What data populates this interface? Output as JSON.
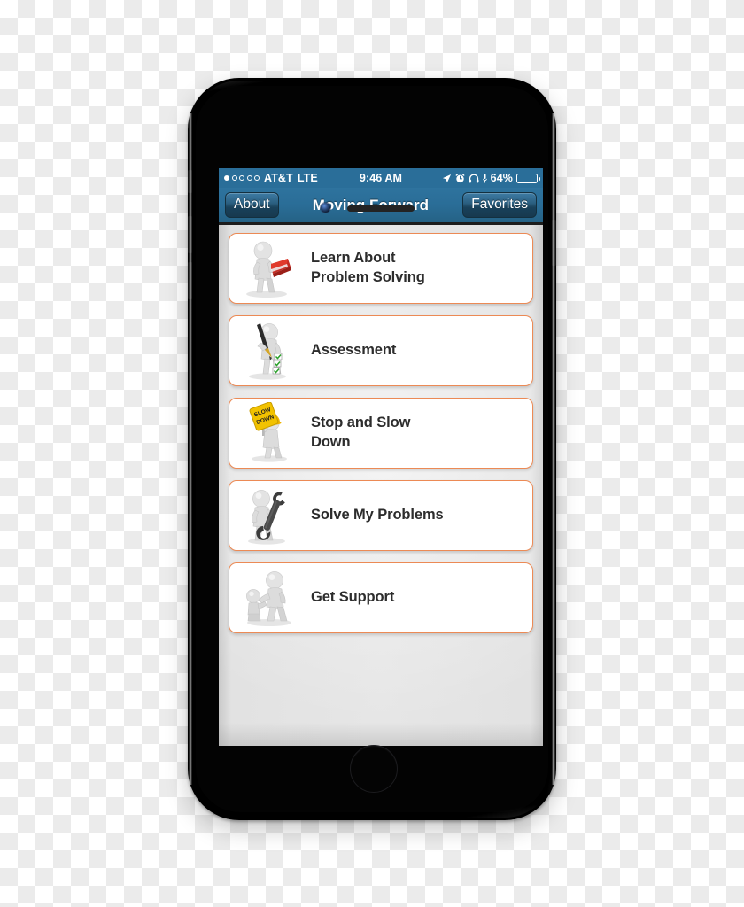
{
  "device": {
    "name": "iphone-mockup",
    "camera": "front-camera",
    "earpiece": "earpiece-speaker",
    "home_button": "home-button",
    "buttons": [
      "mute-switch",
      "volume-up",
      "volume-down",
      "power-button"
    ]
  },
  "status_bar": {
    "signal_dots": [
      true,
      false,
      false,
      false,
      false
    ],
    "carrier": "AT&T",
    "network": "LTE",
    "time": "9:46 AM",
    "icons": [
      "location-arrow-icon",
      "alarm-clock-icon",
      "headphones-icon",
      "microphone-icon"
    ],
    "battery_percent": "64%",
    "battery_level": 64
  },
  "nav_bar": {
    "left_button": "About",
    "title": "Moving Forward",
    "right_button": "Favorites"
  },
  "list": {
    "items": [
      {
        "label": "Learn About\nProblem Solving",
        "line1": "Learn About",
        "line2": "Problem Solving",
        "icon": "person-reading-book-icon"
      },
      {
        "label": "Assessment",
        "line1": "Assessment",
        "line2": "",
        "icon": "person-pen-checklist-icon"
      },
      {
        "label": "Stop and Slow\nDown",
        "line1": "Stop and Slow",
        "line2": "Down",
        "icon": "person-slow-down-sign-icon"
      },
      {
        "label": "Solve My Problems",
        "line1": "Solve My Problems",
        "line2": "",
        "icon": "person-wrench-icon"
      },
      {
        "label": "Get Support",
        "line1": "Get Support",
        "line2": "",
        "icon": "person-helping-person-icon"
      }
    ]
  },
  "colors": {
    "nav_blue": "#2a6e99",
    "card_border_orange": "#ec8a55",
    "screen_background": "#e6e6e6",
    "sign_yellow": "#f2c200",
    "book_red": "#c42b22"
  }
}
